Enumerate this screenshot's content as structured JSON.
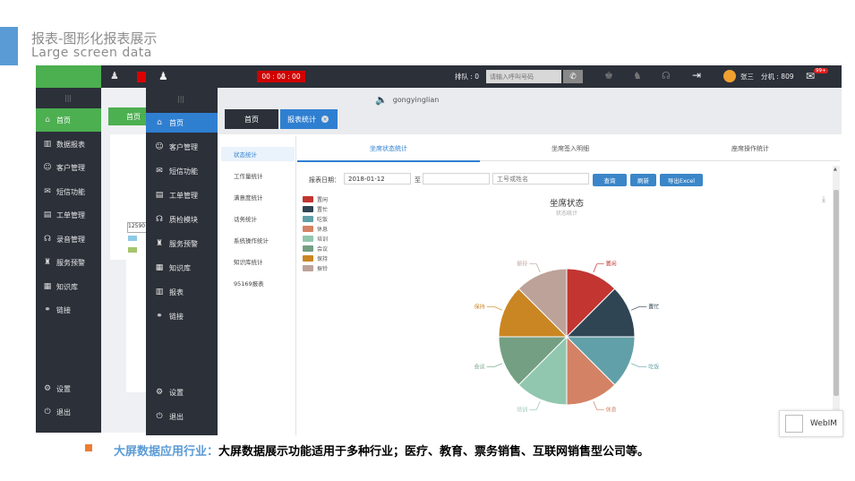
{
  "slide": {
    "title": "报表-图形化报表展示",
    "subtitle": "Large screen data",
    "bullet_highlight": "大屏数据应用行业：",
    "bullet_text": "大屏数据展示功能适用于多种行业；医疗、教育、票务销售、互联网销售型公司等。"
  },
  "back": {
    "menu": [
      {
        "icon": "⌂",
        "label": "首页"
      },
      {
        "icon": "▥",
        "label": "数据报表"
      },
      {
        "icon": "☺",
        "label": "客户管理"
      },
      {
        "icon": "✉",
        "label": "短信功能"
      },
      {
        "icon": "▤",
        "label": "工单管理"
      },
      {
        "icon": "☊",
        "label": "录音管理"
      },
      {
        "icon": "♜",
        "label": "服务预警"
      },
      {
        "icon": "▦",
        "label": "知识库"
      },
      {
        "icon": "⚭",
        "label": "链接"
      }
    ],
    "bottom": [
      {
        "icon": "⚙",
        "label": "设置"
      },
      {
        "icon": "⏻",
        "label": "退出"
      }
    ],
    "tab_home": "首页",
    "input_value": "12590"
  },
  "topbar": {
    "timer": "00 : 00 : 00",
    "queue": "排队 : 0",
    "dial_placeholder": "请输入呼叫号码",
    "user": "张三",
    "extension": "分机 : 809",
    "badge": "99+",
    "speaker_name": "gongyinglian"
  },
  "sidebar": {
    "menu": [
      {
        "icon": "⌂",
        "label": "首页"
      },
      {
        "icon": "☺",
        "label": "客户管理"
      },
      {
        "icon": "✉",
        "label": "短信功能"
      },
      {
        "icon": "▤",
        "label": "工单管理"
      },
      {
        "icon": "☊",
        "label": "质检模块"
      },
      {
        "icon": "♜",
        "label": "服务预警"
      },
      {
        "icon": "▦",
        "label": "知识库"
      },
      {
        "icon": "▥",
        "label": "报表"
      },
      {
        "icon": "⚭",
        "label": "链接"
      }
    ],
    "bottom": [
      {
        "icon": "⚙",
        "label": "设置"
      },
      {
        "icon": "⏻",
        "label": "退出"
      }
    ]
  },
  "tabs": {
    "home": "首页",
    "report": "报表统计"
  },
  "subnav": [
    "状态统计",
    "工作量统计",
    "满意度统计",
    "话务统计",
    "系统操作统计",
    "知识库统计",
    "95169报表"
  ],
  "inner_tabs": [
    "坐席状态统计",
    "坐席签入明细",
    "座席操作统计"
  ],
  "filter": {
    "date_label": "报表日期：",
    "date_from": "2018-01-12",
    "to": "至",
    "agent_placeholder": "工号或姓名",
    "query": "查询",
    "refresh": "刷新",
    "export": "导出Excel"
  },
  "chart_data": {
    "type": "pie",
    "title": "坐席状态",
    "subtitle": "状态统计",
    "categories": [
      "置闲",
      "置忙",
      "吃饭",
      "休息",
      "培训",
      "会议",
      "保持",
      "振铃"
    ],
    "values": [
      1,
      1,
      1,
      1,
      1,
      1,
      1,
      1
    ],
    "colors": [
      "#c23531",
      "#2f4554",
      "#61a0a8",
      "#d48265",
      "#91c7ae",
      "#749f83",
      "#ca8622",
      "#bda29a"
    ]
  },
  "webim": "WebIM"
}
